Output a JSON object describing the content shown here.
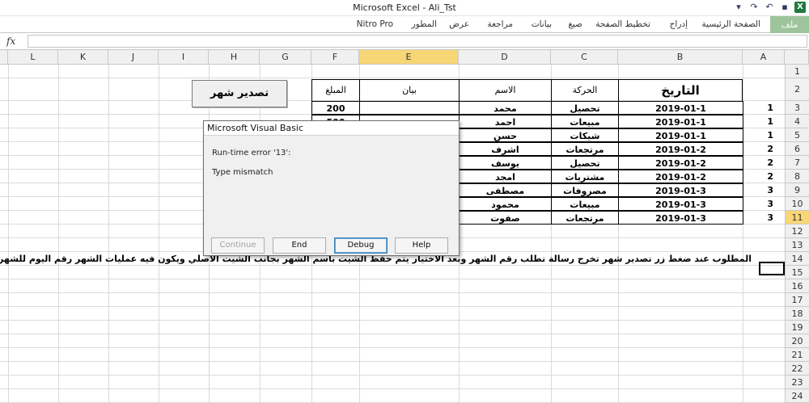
{
  "window": {
    "title": "Microsoft Excel  -  Ali_Tst"
  },
  "ribbon": {
    "file": "ملف",
    "tabs": [
      "الصفحة الرئيسية",
      "إدراج",
      "تخطيط الصفحة",
      "صيغ",
      "بيانات",
      "مراجعة",
      "عرض",
      "المطور",
      "Nitro Pro"
    ]
  },
  "formula_bar": {
    "fx": "fx",
    "value": ""
  },
  "columns": [
    "A",
    "B",
    "C",
    "D",
    "E",
    "F",
    "G",
    "H",
    "I",
    "J",
    "K",
    "L"
  ],
  "rows": [
    "1",
    "2",
    "3",
    "4",
    "5",
    "6",
    "7",
    "8",
    "9",
    "10",
    "11",
    "12",
    "13",
    "14",
    "15",
    "16",
    "17",
    "18",
    "19",
    "20",
    "21",
    "22",
    "23",
    "24"
  ],
  "table": {
    "headers": {
      "date": "التاريخ",
      "movement": "الحركة",
      "name": "الاسم",
      "desc": "بيان",
      "amount": "المبلغ"
    },
    "rows": [
      {
        "a": "1",
        "date": "2019-01-1",
        "movement": "تحصيل",
        "name": "محمد",
        "amount": "200"
      },
      {
        "a": "1",
        "date": "2019-01-1",
        "movement": "مبيعات",
        "name": "احمد",
        "amount": "500"
      },
      {
        "a": "1",
        "date": "2019-01-1",
        "movement": "شيكات",
        "name": "حسن",
        "amount": ""
      },
      {
        "a": "2",
        "date": "2019-01-2",
        "movement": "مرتجعات",
        "name": "اشرف",
        "amount": ""
      },
      {
        "a": "2",
        "date": "2019-01-2",
        "movement": "تحصيل",
        "name": "يوسف",
        "amount": ""
      },
      {
        "a": "2",
        "date": "2019-01-2",
        "movement": "مشتريات",
        "name": "امجد",
        "amount": ""
      },
      {
        "a": "3",
        "date": "2019-01-3",
        "movement": "مصروفات",
        "name": "مصطفى",
        "amount": ""
      },
      {
        "a": "3",
        "date": "2019-01-3",
        "movement": "مبيعات",
        "name": "محمود",
        "amount": ""
      },
      {
        "a": "3",
        "date": "2019-01-3",
        "movement": "مرتجعات",
        "name": "صفوت",
        "amount": ""
      }
    ]
  },
  "export_button": "تصدير شهر",
  "note": "المطلوب عند ضغط زر تصدير شهر تخرج رسالة تطلب رقم الشهر وبعد الاختيار يتم حفظ الشيت باسم الشهر بجانب الشيت الاصلي ويكون فيه عمليات الشهر رقم اليوم للشهر المختار وبيانات كل يوم فى الشيته الخاصه به",
  "dialog": {
    "title": "Microsoft Visual Basic",
    "line1": "Run-time error '13':",
    "line2": "Type mismatch",
    "buttons": {
      "continue": "Continue",
      "end": "End",
      "debug": "Debug",
      "help": "Help"
    }
  }
}
